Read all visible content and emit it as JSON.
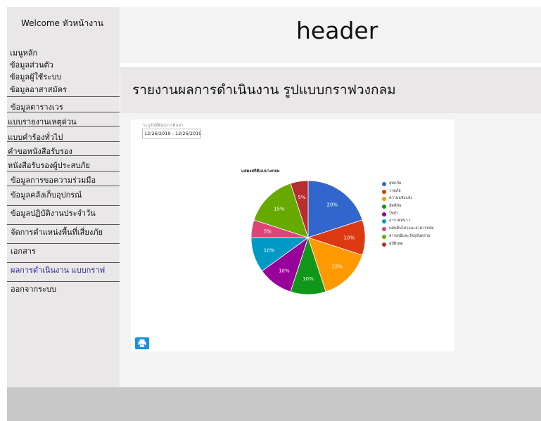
{
  "sidebar": {
    "welcome": "Welcome หัวหน้างาน",
    "links": [
      "เมนูหลัก",
      "ข้อมูลส่วนตัว",
      "ข้อมูลผู้ใช้ระบบ",
      "ข้อมูลอาสาสมัคร"
    ],
    "items": [
      "ข้อมูลตารางเวร",
      "แบบรายงานเหตุด่วน",
      "แบบคำร้องทั่วไป",
      "คำขอหนังสือรับรอง",
      "หนังสือรับรองผู้ประสบภัย",
      "ข้อมูลการขอความร่วมมือ",
      "ข้อมูลคลังเก็บอุปกรณ์",
      "ข้อมูลปฏิบัติงานประจำวัน",
      "จัดการตำแหน่งพื้นที่เสี่ยงภัย",
      "เอกสาร",
      "ผลการดำเนินงาน แบบกราฟ",
      "ออกจากระบบ"
    ],
    "active_item": "ผลการดำเนินงาน แบบกราฟ"
  },
  "header": {
    "title": "header"
  },
  "page": {
    "title": "รายงานผลการดำเนินงาน รูปแบบกราฟวงกลม"
  },
  "filter": {
    "label": "ระบุวันที่ต้องการค้นหา",
    "date_range": "12/26/2019 - 12/26/2019"
  },
  "print_icon": "print-icon",
  "chart_data": {
    "type": "pie",
    "title": "แสดงสถิติแบบวงกลม",
    "slices": [
      {
        "label": "อุทกภัย",
        "value": 20,
        "color": "#3366cc"
      },
      {
        "label": "วาตภัย",
        "value": 10,
        "color": "#dc3912"
      },
      {
        "label": "ความแห้งแล้ง",
        "value": 15,
        "color": "#ff9900"
      },
      {
        "label": "อัคคีภัย",
        "value": 10,
        "color": "#109618"
      },
      {
        "label": "ไฟป่า",
        "value": 10,
        "color": "#990099"
      },
      {
        "label": "อากาศหนาว",
        "value": 10,
        "color": "#0099c6"
      },
      {
        "label": "แผ่นดินไหวและอาคารถล่ม",
        "value": 5,
        "color": "#dd4477"
      },
      {
        "label": "สารเคมีและวัตถุอันตราย",
        "value": 15,
        "color": "#66aa00"
      },
      {
        "label": "อุบัติเหตุ",
        "value": 5,
        "color": "#b82e2e"
      }
    ],
    "legend_position": "right"
  }
}
